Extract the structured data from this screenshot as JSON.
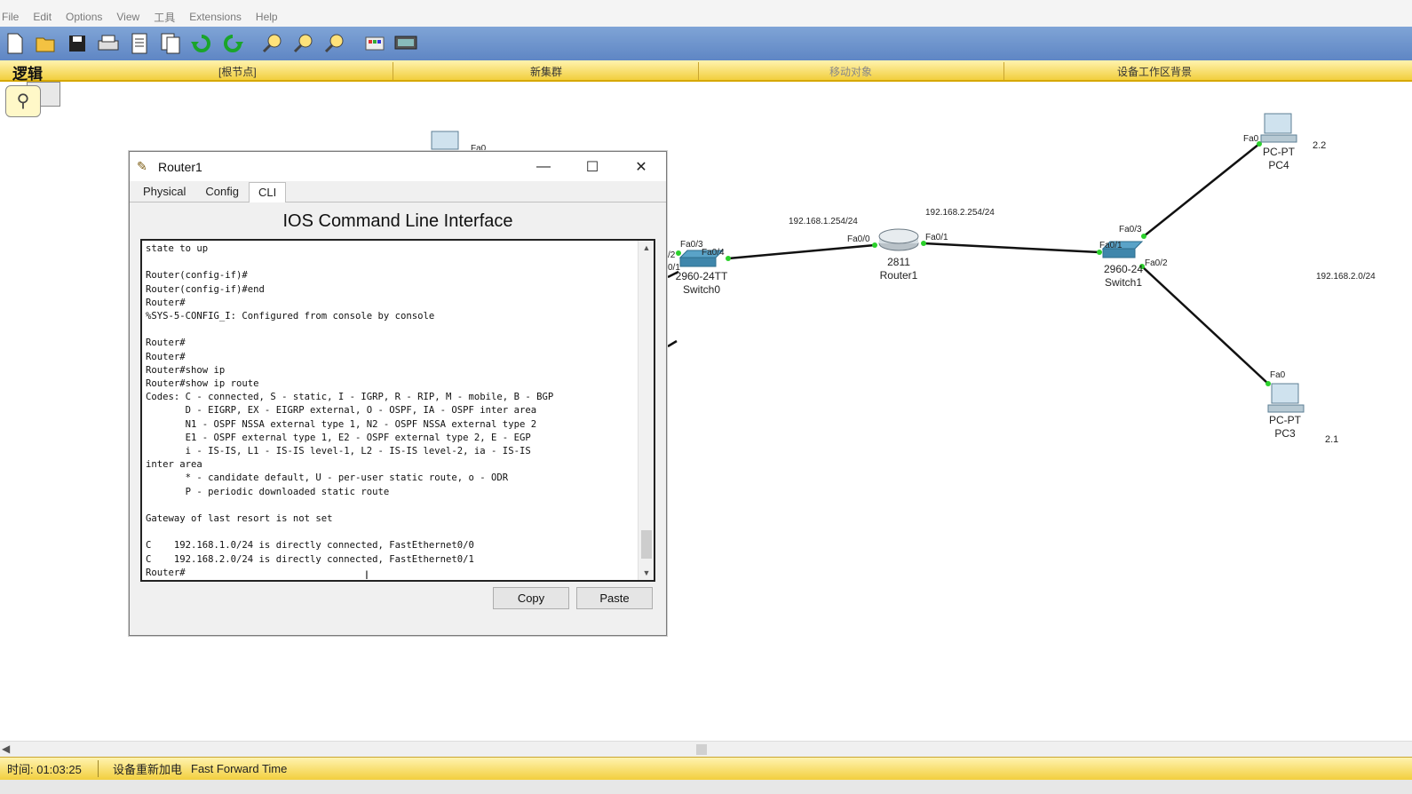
{
  "menu": [
    "File",
    "Edit",
    "Options",
    "View",
    "工具",
    "Extensions",
    "Help"
  ],
  "toolbar_icons": [
    "new-file-icon",
    "open-folder-icon",
    "save-icon",
    "print-icon",
    "activity-wizard-icon",
    "copy-icon",
    "undo-icon",
    "redo-icon",
    "zoom-in-icon",
    "zoom-reset-icon",
    "zoom-out-icon",
    "palette-icon",
    "device-icon"
  ],
  "workspace": {
    "logic_label": "逻辑",
    "root_node": "[根节点]",
    "new_cluster": "新集群",
    "move_object": "移动对象",
    "workspace_background": "设备工作区背景"
  },
  "network": {
    "switch0": {
      "model": "2960-24TT",
      "name": "Switch0",
      "ports": [
        "Fa0/3",
        "Fa0/4",
        "/2",
        "0/1"
      ]
    },
    "router1": {
      "model": "2811",
      "name": "Router1",
      "port_left": "Fa0/0",
      "port_right": "Fa0/1"
    },
    "switch1": {
      "model": "2960-24",
      "name": "Switch1",
      "ports": [
        "Fa0/3",
        "Fa0/1",
        "Fa0/2"
      ]
    },
    "pc4": {
      "model": "PC-PT",
      "name": "PC4",
      "port": "Fa0",
      "addr": "2.2"
    },
    "pc3": {
      "model": "PC-PT",
      "name": "PC3",
      "port": "Fa0",
      "addr": "2.1"
    },
    "partial_pc_port": "Fa0",
    "net_labels": {
      "r_left": "192.168.1.254/24",
      "r_right": "192.168.2.254/24",
      "lan2": "192.168.2.0/24"
    }
  },
  "dialog": {
    "title": "Router1",
    "tabs": [
      "Physical",
      "Config",
      "CLI"
    ],
    "active_tab": "CLI",
    "heading": "IOS Command Line Interface",
    "terminal": "state to up\n\nRouter(config-if)#\nRouter(config-if)#end\nRouter#\n%SYS-5-CONFIG_I: Configured from console by console\n\nRouter#\nRouter#\nRouter#show ip\nRouter#show ip route\nCodes: C - connected, S - static, I - IGRP, R - RIP, M - mobile, B - BGP\n       D - EIGRP, EX - EIGRP external, O - OSPF, IA - OSPF inter area\n       N1 - OSPF NSSA external type 1, N2 - OSPF NSSA external type 2\n       E1 - OSPF external type 1, E2 - OSPF external type 2, E - EGP\n       i - IS-IS, L1 - IS-IS level-1, L2 - IS-IS level-2, ia - IS-IS\ninter area\n       * - candidate default, U - per-user static route, o - ODR\n       P - periodic downloaded static route\n\nGateway of last resort is not set\n\nC    192.168.1.0/24 is directly connected, FastEthernet0/0\nC    192.168.2.0/24 is directly connected, FastEthernet0/1\nRouter#",
    "copy_label": "Copy",
    "paste_label": "Paste"
  },
  "status": {
    "time": "时间: 01:03:25",
    "power_cycle": "设备重新加电",
    "fast_forward": "Fast Forward Time"
  }
}
